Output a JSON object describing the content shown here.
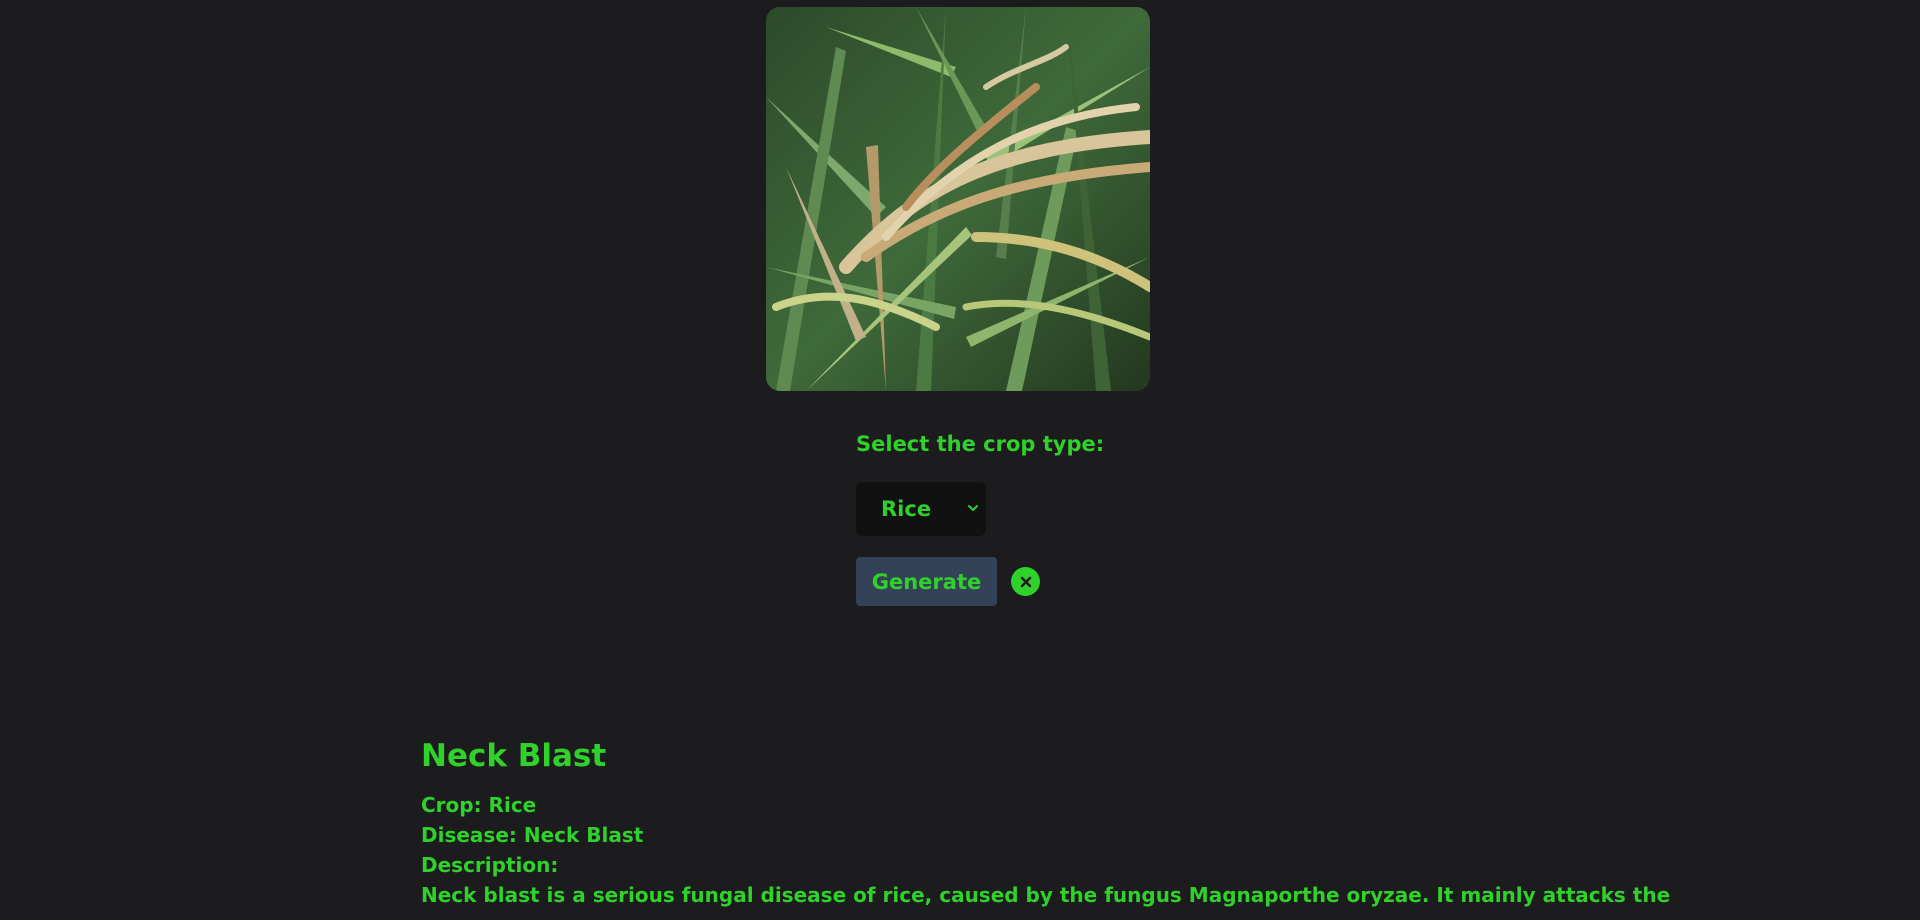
{
  "form": {
    "crop_label": "Select the crop type:",
    "crop_selected": "Rice",
    "generate_label": "Generate"
  },
  "result": {
    "title": "Neck Blast",
    "crop_line": "Crop: Rice",
    "disease_line": "Disease: Neck Blast",
    "description_heading": "Description:",
    "description_text": "Neck blast is a serious fungal disease of rice, caused by the fungus Magnaporthe oryzae. It mainly attacks the"
  },
  "icons": {
    "select_chevron": "chevron-down-icon",
    "clear": "close-icon"
  },
  "colors": {
    "background": "#1c1b1d",
    "accent_green": "#2fd12a",
    "button_bg": "#344257",
    "select_bg": "#111112"
  }
}
